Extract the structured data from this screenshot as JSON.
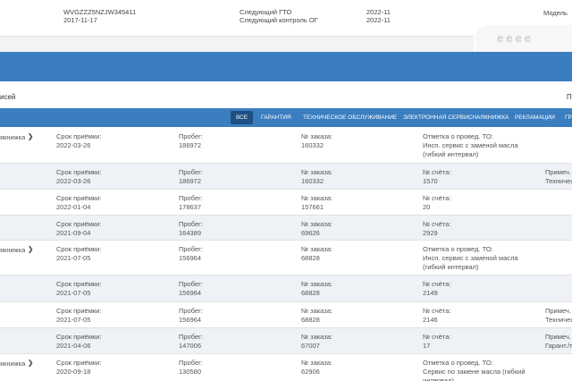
{
  "header": {
    "vin": "WVGZZZ5NZJW345411",
    "date": "2017-11-17",
    "next_gto_label": "Следующий ГТО",
    "next_gto_value": "2022-11",
    "next_og_label": "Следующий контроль ОГ",
    "next_og_value": "2022-11",
    "model_label": "Модель",
    "watermark": "eeee"
  },
  "records": {
    "label": "исей",
    "right": "П"
  },
  "tabs": [
    "ВСЕ",
    "ГАРАНТИЯ",
    "ТЕХНИЧЕСКОЕ ОБСЛУЖИВАНИЕ",
    "ЭЛЕКТРОННАЯ СЕРВИСНАЯКНИЖКА",
    "РЕКЛАМАЦИИ",
    "ГР"
  ],
  "rows": [
    {
      "c0": "якнижка",
      "chev": "❯",
      "c1a": "Срок приёмки:",
      "c1b": "2022-03-26",
      "c2a": "Пробег:",
      "c2b": "186972",
      "c3a": "№ заказа:",
      "c3b": "160332",
      "c4a": "Отметка о провед. ТО:",
      "c4b": "Инсп. сервис с заменой масла",
      "c4c": "(гибкий интервал)",
      "c5a": "",
      "c5b": ""
    },
    {
      "c0": "",
      "chev": "",
      "c1a": "Срок приёмки:",
      "c1b": "2022-03-26",
      "c2a": "Пробег:",
      "c2b": "186972",
      "c3a": "№ заказа:",
      "c3b": "160332",
      "c4a": "№ счёта:",
      "c4b": "1570",
      "c4c": "",
      "c5a": "Примеч.",
      "c5b": "Техничес"
    },
    {
      "c0": "",
      "chev": "",
      "c1a": "Срок приёмки:",
      "c1b": "2022-01-04",
      "c2a": "Пробег:",
      "c2b": "178637",
      "c3a": "№ заказа:",
      "c3b": "157661",
      "c4a": "№ счёта:",
      "c4b": "20",
      "c4c": "",
      "c5a": "",
      "c5b": ""
    },
    {
      "c0": "",
      "chev": "",
      "c1a": "Срок приёмки:",
      "c1b": "2021-09-04",
      "c2a": "Пробег:",
      "c2b": "164389",
      "c3a": "№ заказа:",
      "c3b": "69626",
      "c4a": "№ счёта:",
      "c4b": "2929",
      "c4c": "",
      "c5a": "",
      "c5b": ""
    },
    {
      "c0": "якнижка",
      "chev": "❯",
      "c1a": "Срок приёмки:",
      "c1b": "2021-07-05",
      "c2a": "Пробег:",
      "c2b": "156964",
      "c3a": "№ заказа:",
      "c3b": "68828",
      "c4a": "Отметка о провед. ТО:",
      "c4b": "Инсп. сервис с заменой масла",
      "c4c": "(гибкий интервал)",
      "c5a": "",
      "c5b": ""
    },
    {
      "c0": "",
      "chev": "",
      "c1a": "Срок приёмки:",
      "c1b": "2021-07-05",
      "c2a": "Пробег:",
      "c2b": "156964",
      "c3a": "№ заказа:",
      "c3b": "68828",
      "c4a": "№ счёта:",
      "c4b": "2149",
      "c4c": "",
      "c5a": "",
      "c5b": ""
    },
    {
      "c0": "",
      "chev": "",
      "c1a": "Срок приёмки:",
      "c1b": "2021-07-05",
      "c2a": "Пробег:",
      "c2b": "156964",
      "c3a": "№ заказа:",
      "c3b": "68828",
      "c4a": "№ счёта:",
      "c4b": "2146",
      "c4c": "",
      "c5a": "Примеч.",
      "c5b": "Техничес"
    },
    {
      "c0": "",
      "chev": "",
      "c1a": "Срок приёмки:",
      "c1b": "2021-04-06",
      "c2a": "Пробег:",
      "c2b": "147006",
      "c3a": "№ заказа:",
      "c3b": "67007",
      "c4a": "№ счёта:",
      "c4b": "17",
      "c4c": "",
      "c5a": "Примеч.",
      "c5b": "Гарант./т"
    },
    {
      "c0": "якнижка",
      "chev": "❯",
      "c1a": "Срок приёмки:",
      "c1b": "2020-09-18",
      "c2a": "Пробег:",
      "c2b": "130580",
      "c3a": "№ заказа:",
      "c3b": "62906",
      "c4a": "Отметка о провед. ТО:",
      "c4b": "Сервис по замене масла (гибкий",
      "c4c": "интервал)",
      "c5a": "",
      "c5b": ""
    }
  ]
}
